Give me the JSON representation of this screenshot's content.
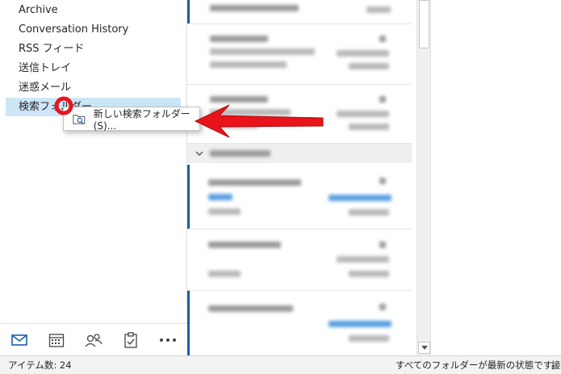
{
  "folders": [
    {
      "label": "Archive"
    },
    {
      "label": "Conversation History"
    },
    {
      "label": "RSS フィード"
    },
    {
      "label": "送信トレイ"
    },
    {
      "label": "迷惑メール"
    },
    {
      "label": "検索フォルダー"
    }
  ],
  "context_menu": {
    "new_search_folder": "新しい検索フォルダー(S)..."
  },
  "bottom_nav": [
    "mail-icon",
    "calendar-icon",
    "people-icon",
    "tasks-icon",
    "more-icon"
  ],
  "status_bar": {
    "item_count": "アイテム数: 24",
    "sync_status": "すべてのフォルダーが最新の状態です。",
    "extra": "接"
  },
  "colors": {
    "selection": "#cde6f7",
    "accent": "#1a5ea8",
    "annotation_red": "#e8141a"
  }
}
